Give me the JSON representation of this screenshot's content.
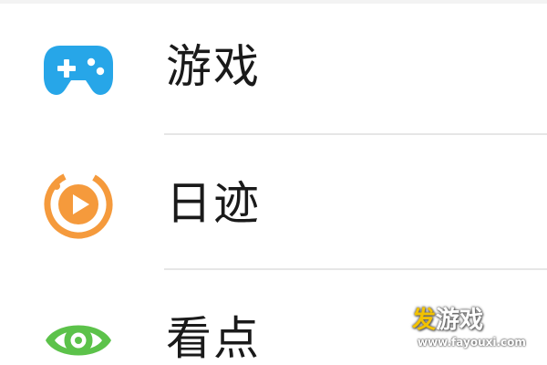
{
  "menu": {
    "items": [
      {
        "label": "游戏",
        "icon": "gamepad-icon",
        "color": "#27a6e8"
      },
      {
        "label": "日迹",
        "icon": "video-moments-icon",
        "color": "#f59a3c"
      },
      {
        "label": "看点",
        "icon": "eye-icon",
        "color": "#5cc24a"
      }
    ]
  },
  "watermark": {
    "brand_accent": "发",
    "brand_rest": "游戏",
    "url": "www.fayouxi.com"
  }
}
